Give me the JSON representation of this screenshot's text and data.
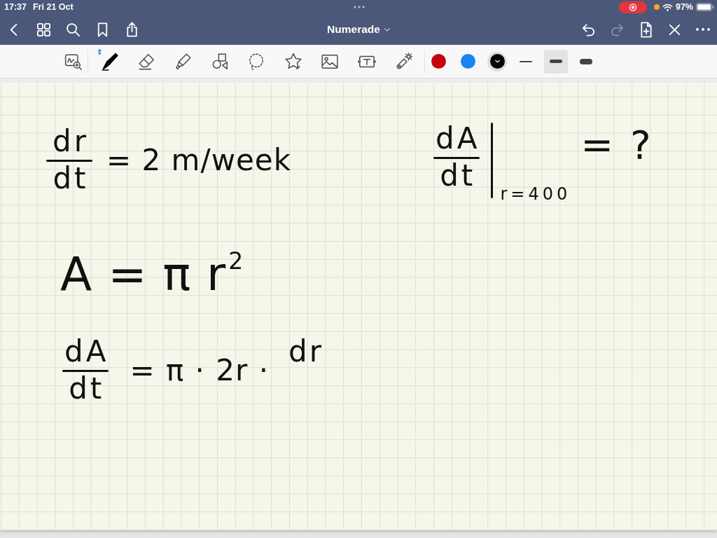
{
  "status_bar": {
    "time": "17:37",
    "date": "Fri 21 Oct",
    "recording": true,
    "battery": "97%"
  },
  "nav_bar": {
    "left": [
      {
        "kind": "back"
      },
      {
        "kind": "thumbnails"
      },
      {
        "kind": "search"
      },
      {
        "kind": "bookmark"
      },
      {
        "kind": "share"
      }
    ],
    "title": "Numerade",
    "right": [
      {
        "kind": "undo",
        "disabled": false
      },
      {
        "kind": "redo",
        "disabled": true
      },
      {
        "kind": "add-page",
        "disabled": false
      },
      {
        "kind": "cross",
        "disabled": false
      },
      {
        "kind": "more",
        "disabled": false
      }
    ]
  },
  "toolbar": {
    "stylus_connected": true,
    "tools": [
      {
        "kind": "zoom-window",
        "selected": false
      },
      {
        "kind": "pen",
        "selected": true
      },
      {
        "kind": "eraser",
        "selected": false
      },
      {
        "kind": "highlighter",
        "selected": false
      },
      {
        "kind": "shapes",
        "selected": false
      },
      {
        "kind": "lasso",
        "selected": false
      },
      {
        "kind": "sticker",
        "selected": false
      },
      {
        "kind": "image",
        "selected": false
      },
      {
        "kind": "text",
        "selected": false
      },
      {
        "kind": "laser",
        "selected": false
      }
    ],
    "colors": [
      {
        "color": "#c8000c",
        "selected": false
      },
      {
        "color": "#1a84f2",
        "selected": false
      },
      {
        "color": "#000000",
        "selected": true
      }
    ],
    "widths": [
      {
        "kind": "thin",
        "selected": false
      },
      {
        "kind": "medium",
        "selected": true
      },
      {
        "kind": "thick",
        "selected": false
      }
    ]
  },
  "page": {
    "rows": [
      [
        {
          "kind": "fraction-line",
          "numerator": "dr",
          "denominator": "dt",
          "rest": "= 2 m/week"
        },
        {
          "kind": "evaluated-derivative",
          "numerator": "dA",
          "denominator": "dt",
          "at": "r=400",
          "rest": "= ?"
        }
      ],
      [
        {
          "kind": "line",
          "text": "A = π r$^{2}$"
        }
      ],
      [
        {
          "kind": "fraction-line",
          "numerator": "dA",
          "denominator": "dt",
          "rest": "= π · 2r ·",
          "partial_numerator": "dr"
        }
      ]
    ]
  }
}
